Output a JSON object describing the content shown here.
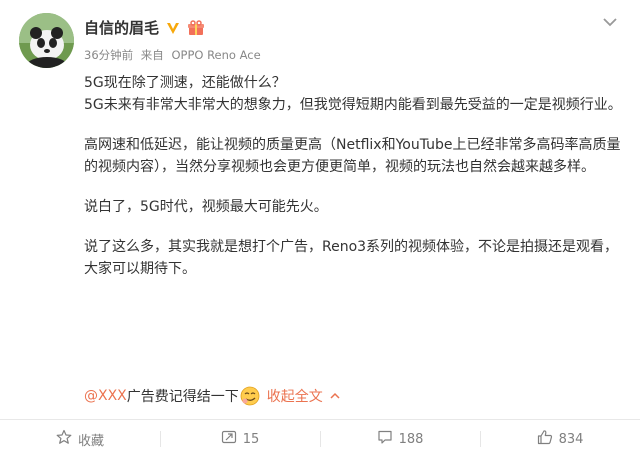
{
  "post": {
    "username": "自信的眉毛",
    "meta": {
      "time": "36分钟前",
      "source_prefix": "来自",
      "device": "OPPO Reno Ace"
    },
    "paragraphs": [
      "5G现在除了测速，还能做什么？",
      "5G未来有非常大非常大的想象力，但我觉得短期内能看到最先受益的一定是视频行业。",
      "高网速和低延迟，能让视频的质量更高（Netflix和YouTube上已经非常多高码率高质量的视频内容），当然分享视频也会更方便更简单，视频的玩法也自然会越来越多样。",
      "说白了，5G时代，视频最大可能先火。",
      "说了这么多，其实我就是想打个广告，Reno3系列的视频体验，不论是拍摄还是观看，大家可以期待下。"
    ],
    "mention": "@XXX",
    "after_mention": " 广告费记得结一下",
    "collapse_label": "收起全文"
  },
  "actions": {
    "favorite_label": "收藏",
    "repost_count": "15",
    "comment_count": "188",
    "like_count": "834"
  },
  "colors": {
    "accent": "#eb7350",
    "vip": "#f7a80b"
  },
  "icons": [
    "avatar-panda",
    "vip-badge-icon",
    "gift-icon",
    "chevron-down-icon",
    "star-icon",
    "repost-icon",
    "comment-icon",
    "like-icon",
    "smirk-emoji-icon"
  ]
}
